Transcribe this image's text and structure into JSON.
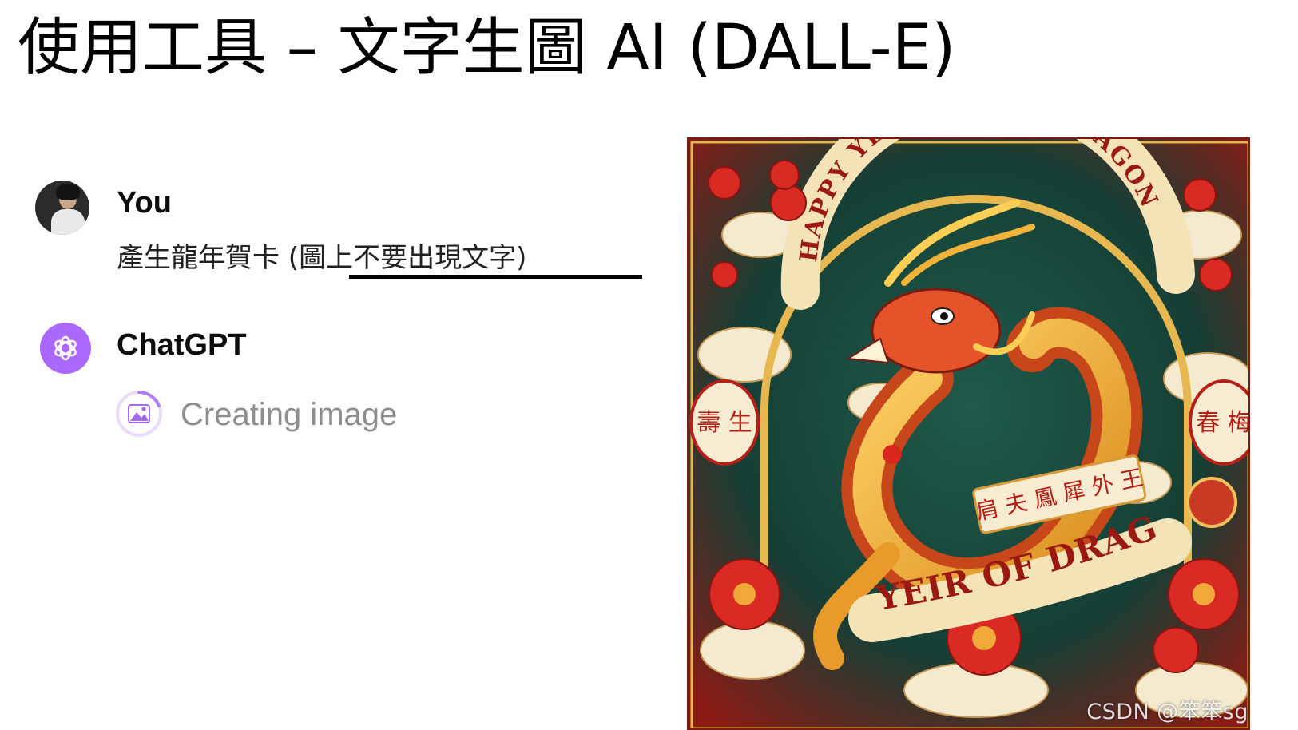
{
  "slide": {
    "title": "使用工具 – 文字生圖 AI (DALL-E)"
  },
  "conversation": {
    "user": {
      "name": "You",
      "message": "產生龍年賀卡 (圖上不要出現文字)"
    },
    "assistant": {
      "name": "ChatGPT",
      "status": "Creating image",
      "status_icon": "image-icon"
    }
  },
  "generated_image": {
    "banner_top": "HAPPY YEAR OF THE DRAGON",
    "banner_bottom": "YEIR OF DRAGON",
    "scroll_text": "肩 夫 鳳 犀 外 王",
    "left_medallion": "壽 生",
    "right_medallion": "春 梅",
    "watermark": "CSDN @笨笨sg"
  },
  "colors": {
    "accent_purple": "#ab68ff",
    "card_red": "#c0241a",
    "status_gray": "#8e8e8e"
  }
}
